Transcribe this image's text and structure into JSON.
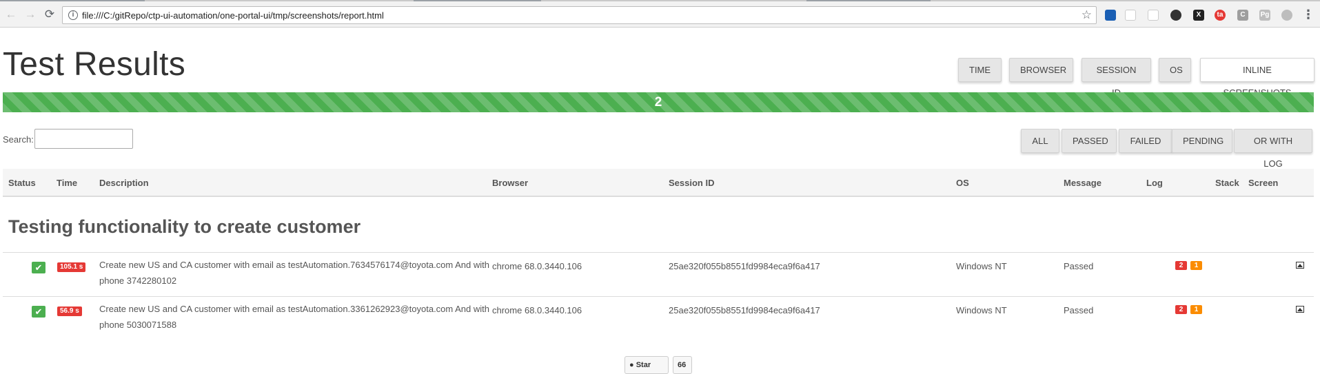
{
  "browser": {
    "url": "file:///C:/gitRepo/ctp-ui-automation/one-portal-ui/tmp/screenshots/report.html",
    "info_icon": "info-icon",
    "bookmark_icon": "star-icon",
    "extensions": [
      {
        "name": "extension-blue-icon",
        "color": "#1a5fb4",
        "glyph": ""
      },
      {
        "name": "extension-ribbon-icon",
        "color": "#ffffff",
        "glyph": ""
      },
      {
        "name": "extension-network-icon",
        "color": "#ffffff",
        "glyph": ""
      },
      {
        "name": "extension-dark-circle-icon",
        "color": "#333333",
        "glyph": ""
      },
      {
        "name": "extension-x-icon",
        "color": "#222222",
        "glyph": "X"
      },
      {
        "name": "extension-red-circle-icon",
        "color": "#e53935",
        "glyph": "ta"
      },
      {
        "name": "extension-c-icon",
        "color": "#9e9e9e",
        "glyph": "C"
      },
      {
        "name": "extension-pg-icon",
        "color": "#bdbdbd",
        "glyph": "Pg"
      },
      {
        "name": "extension-gray-circle-icon",
        "color": "#bdbdbd",
        "glyph": ""
      }
    ],
    "menu_glyph": "⋮"
  },
  "report": {
    "title": "Test Results",
    "view_buttons": [
      "TIME",
      "BROWSER",
      "SESSION ID",
      "OS",
      "INLINE SCREENSHOTS"
    ],
    "progress": {
      "count": "2",
      "passed_fraction": 1.0,
      "color": "#4caf50"
    },
    "search": {
      "label": "Search:",
      "value": ""
    },
    "filter_buttons": [
      "ALL",
      "PASSED",
      "FAILED",
      "PENDING",
      "OR WITH LOG"
    ],
    "columns": [
      "Status",
      "Time",
      "Description",
      "Browser",
      "Session ID",
      "OS",
      "Message",
      "Log",
      "Stack",
      "Screen"
    ],
    "group_title": "Testing functionality to create customer",
    "rows": [
      {
        "status": "✔",
        "time": "105.1 s",
        "description": "Create new US and CA customer with email as testAutomation.7634576174@toyota.com And with phone 3742280102",
        "browser": "chrome 68.0.3440.106",
        "session_id": "25ae320f055b8551fd9984eca9f6a417",
        "os": "Windows NT",
        "message": "Passed",
        "log_errors": "2",
        "log_warnings": "1",
        "screen_icon": "image-icon"
      },
      {
        "status": "✔",
        "time": "56.9 s",
        "description": "Create new US and CA customer with email as testAutomation.3361262923@toyota.com And with phone 5030071588",
        "browser": "chrome 68.0.3440.106",
        "session_id": "25ae320f055b8551fd9984eca9f6a417",
        "os": "Windows NT",
        "message": "Passed",
        "log_errors": "2",
        "log_warnings": "1",
        "screen_icon": "image-icon"
      }
    ],
    "footer": {
      "star_label": "Star",
      "star_count": "66"
    }
  }
}
